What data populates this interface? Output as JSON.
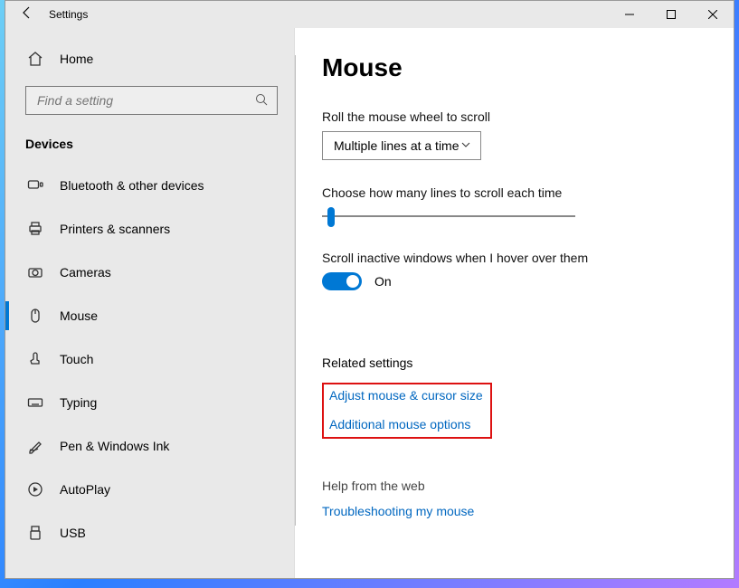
{
  "window": {
    "title": "Settings"
  },
  "sidebar": {
    "home": "Home",
    "search_placeholder": "Find a setting",
    "section": "Devices",
    "items": [
      {
        "label": "Bluetooth & other devices"
      },
      {
        "label": "Printers & scanners"
      },
      {
        "label": "Cameras"
      },
      {
        "label": "Mouse"
      },
      {
        "label": "Touch"
      },
      {
        "label": "Typing"
      },
      {
        "label": "Pen & Windows Ink"
      },
      {
        "label": "AutoPlay"
      },
      {
        "label": "USB"
      }
    ]
  },
  "main": {
    "title": "Mouse",
    "scroll_label": "Roll the mouse wheel to scroll",
    "scroll_value": "Multiple lines at a time",
    "lines_label": "Choose how many lines to scroll each time",
    "inactive_label": "Scroll inactive windows when I hover over them",
    "toggle_state": "On",
    "related_title": "Related settings",
    "link_adjust": "Adjust mouse & cursor size",
    "link_additional": "Additional mouse options",
    "help_title": "Help from the web",
    "link_trouble": "Troubleshooting my mouse"
  }
}
